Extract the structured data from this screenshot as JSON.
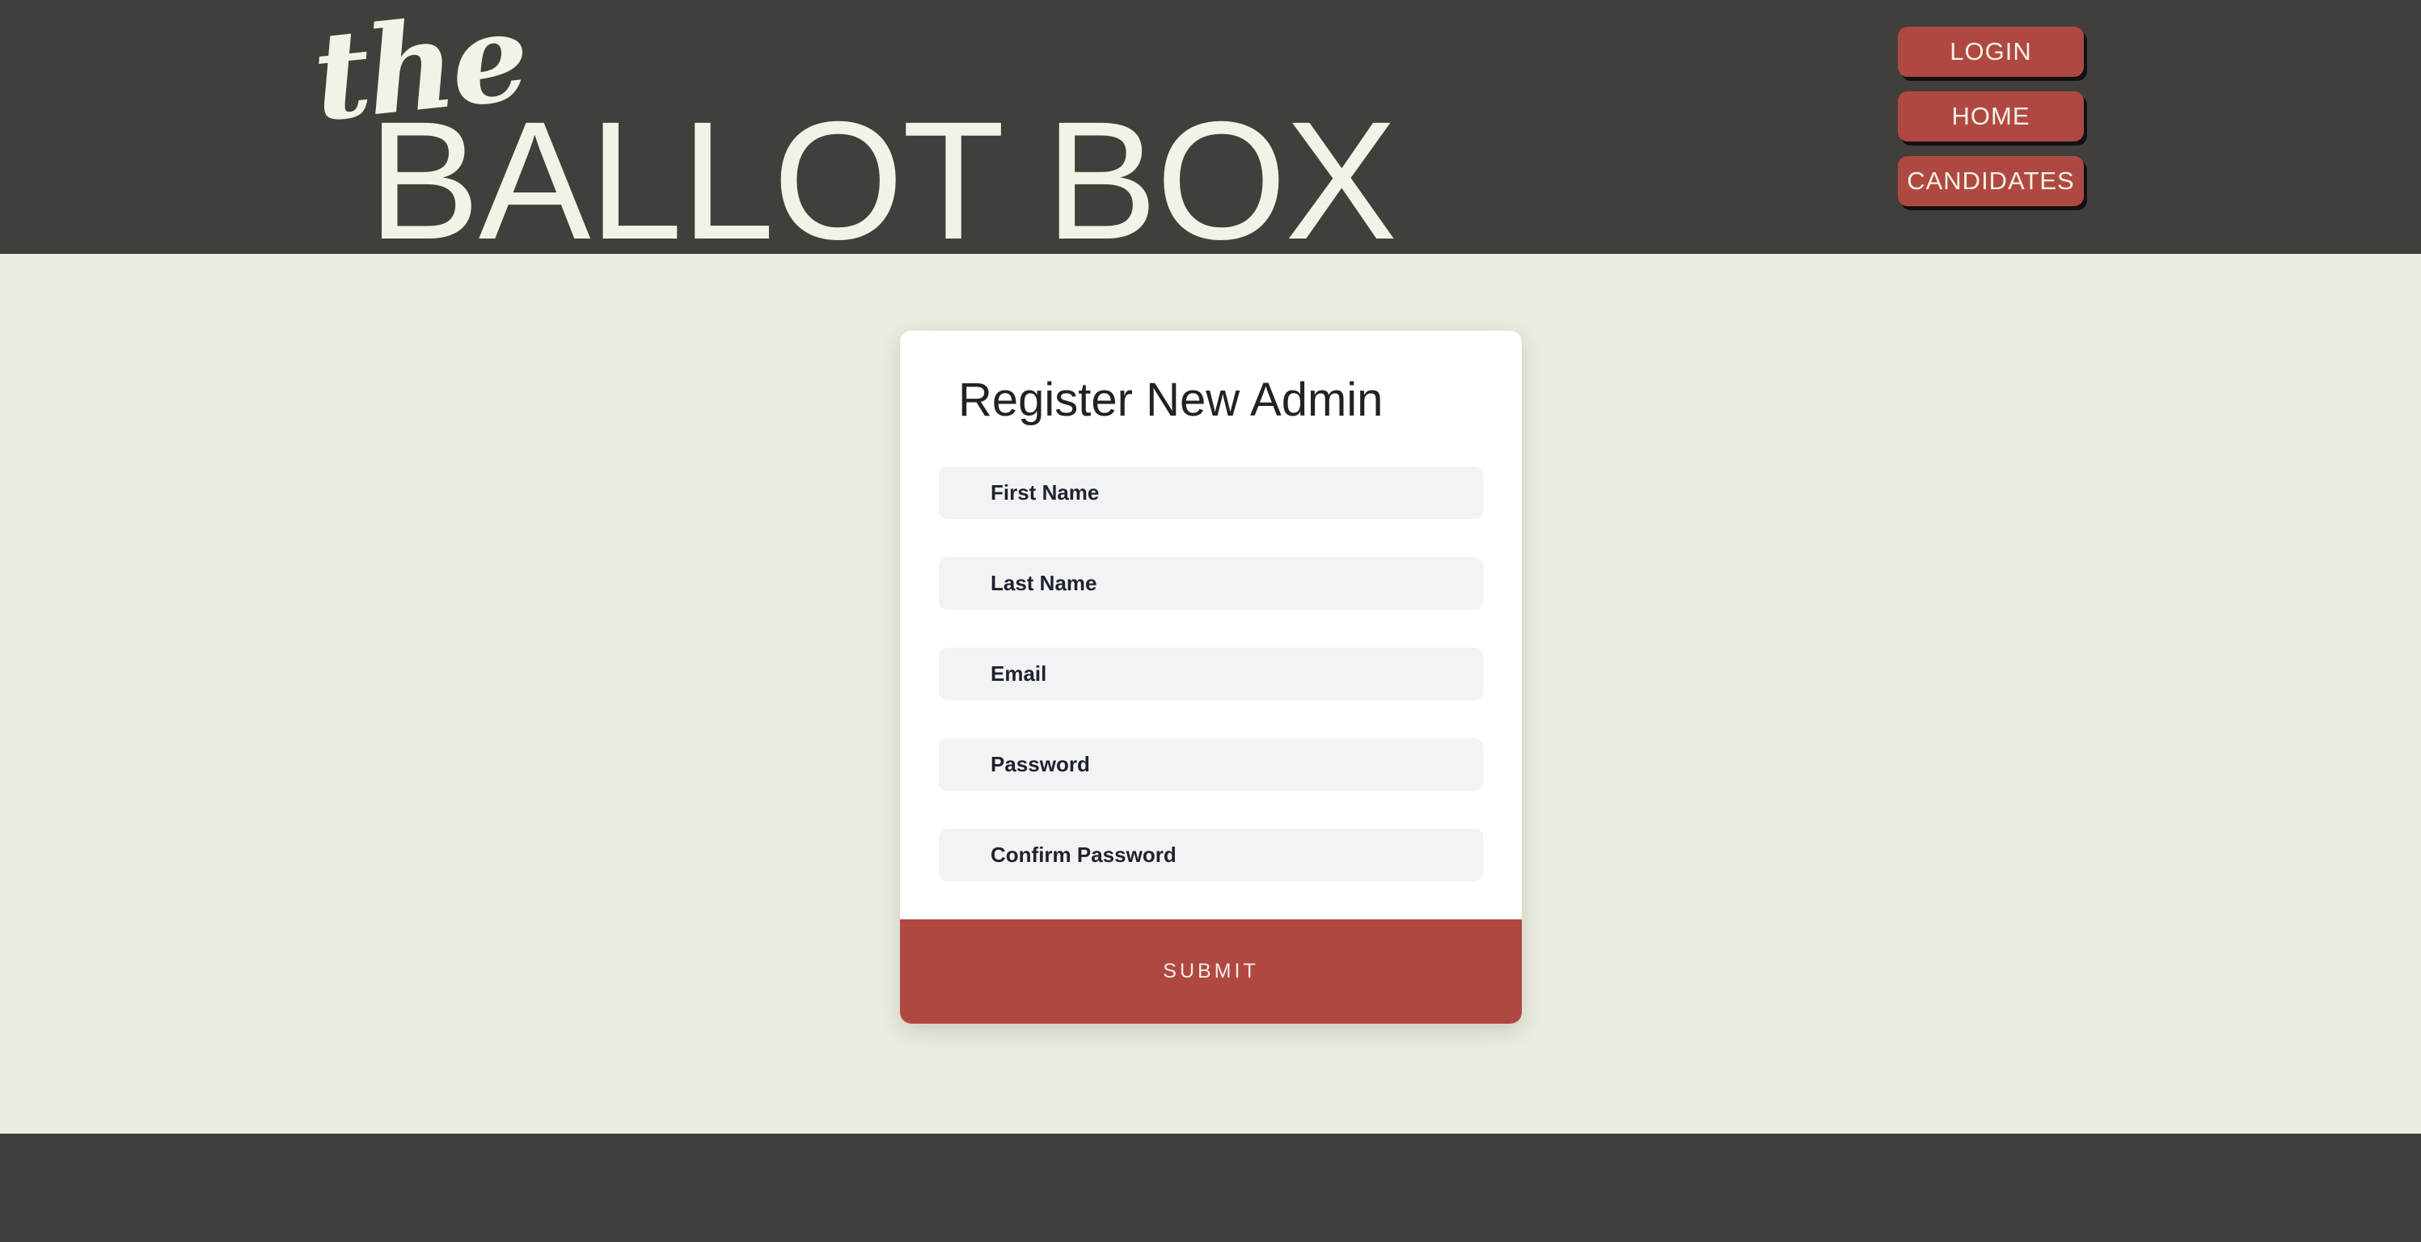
{
  "header": {
    "logo_the": "the",
    "logo_main": "BALLOT BOX",
    "nav": [
      {
        "label": "LOGIN"
      },
      {
        "label": "HOME"
      },
      {
        "label": "CANDIDATES"
      }
    ]
  },
  "form": {
    "title": "Register New Admin",
    "fields": [
      {
        "placeholder": "First Name",
        "value": ""
      },
      {
        "placeholder": "Last Name",
        "value": ""
      },
      {
        "placeholder": "Email",
        "value": ""
      },
      {
        "placeholder": "Password",
        "value": ""
      },
      {
        "placeholder": "Confirm Password",
        "value": ""
      }
    ],
    "submit_label": "SUBMIT"
  },
  "colors": {
    "header_bg": "#403f3b",
    "page_bg": "#ebecdf",
    "accent": "#b04842",
    "logo_text": "#f3f2e6",
    "input_bg": "#f2f3f5"
  }
}
